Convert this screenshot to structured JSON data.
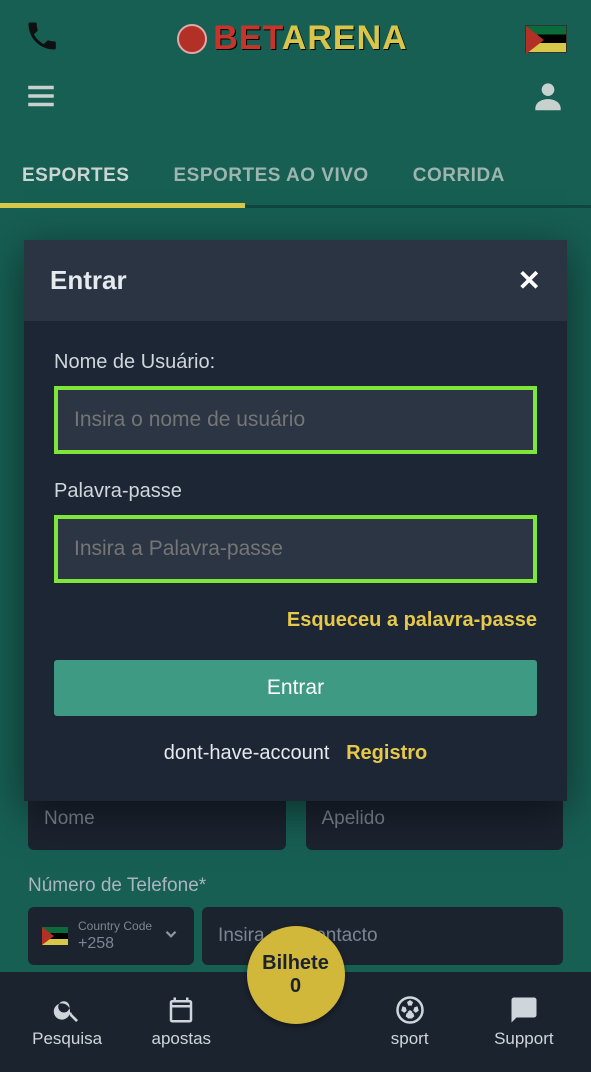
{
  "brand": {
    "part1": "BET",
    "part2": "ARENA"
  },
  "tabs": [
    {
      "label": "ESPORTES",
      "active": true
    },
    {
      "label": "ESPORTES AO VIVO",
      "active": false
    },
    {
      "label": "CORRIDA",
      "active": false
    }
  ],
  "modal": {
    "title": "Entrar",
    "username_label": "Nome de Usuário:",
    "username_placeholder": "Insira o nome de usuário",
    "password_label": "Palavra-passe",
    "password_placeholder": "Insira a Palavra-passe",
    "forgot": "Esqueceu a palavra-passe",
    "login_button": "Entrar",
    "no_account": "dont-have-account",
    "register": "Registro"
  },
  "bgform": {
    "firstname_placeholder": "Nome",
    "lastname_placeholder": "Apelido",
    "phone_label": "Número de Telefone*",
    "country_code_label": "Country Code",
    "country_code": "+258",
    "contact_placeholder": "Insira seu contacto"
  },
  "ticket": {
    "label": "Bilhete",
    "count": "0"
  },
  "bottomnav": {
    "search": "Pesquisa",
    "bets": "apostas",
    "sport": "sport",
    "support": "Support"
  }
}
